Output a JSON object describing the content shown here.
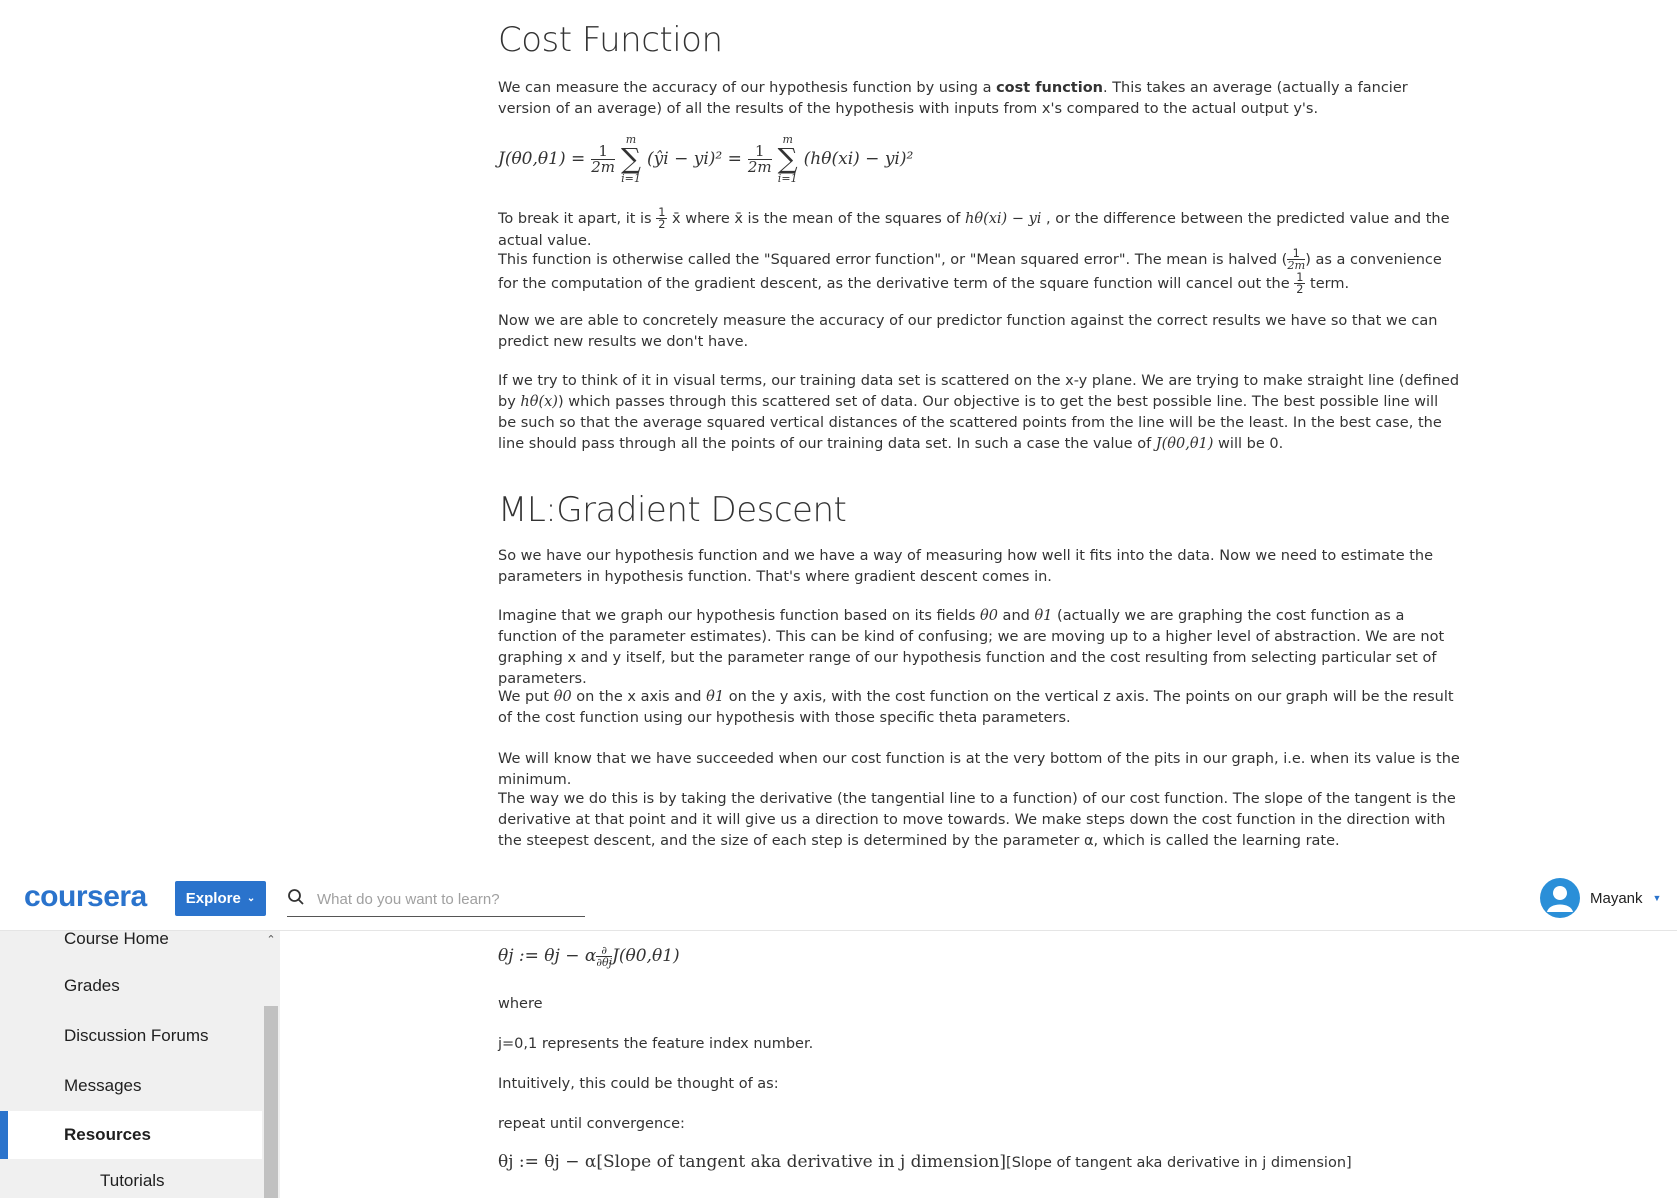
{
  "article": {
    "h1": "Cost Function",
    "p1_a": "We can measure the accuracy of our hypothesis function by using a ",
    "p1_bold": "cost function",
    "p1_b": ". This takes an average (actually a fancier version of an average) of all the results of the hypothesis with inputs from x's compared to the actual output y's.",
    "eq1": {
      "lhs": "J(θ0,θ1) =",
      "frac_num": "1",
      "frac_den": "2m",
      "sum_top": "m",
      "sum_bot": "i=1",
      "term1": "(ŷi − yi)² =",
      "term2": "(hθ(xi) − yi)²"
    },
    "p2_a": "To break it apart, it is ",
    "p2_frac_num": "1",
    "p2_frac_den": "2",
    "p2_b": " x̄ where x̄ is the mean of the squares of ",
    "p2_math": "hθ(xi) − yi",
    "p2_c": " , or the difference between the predicted value and the actual value.",
    "p3_a": "This function is otherwise called the \"Squared error function\", or \"Mean squared error\". The mean is halved ",
    "p3_frac_num": "1",
    "p3_frac_den": "2m",
    "p3_b": " as a convenience for the computation of the gradient descent, as the derivative term of the square function will cancel out the ",
    "p3_frac2_num": "1",
    "p3_frac2_den": "2",
    "p3_c": " term.",
    "p4": "Now we are able to concretely measure the accuracy of our predictor function against the correct results we have so that we can predict new results we don't have.",
    "p5_a": "If we try to think of it in visual terms, our training data set is scattered on the x-y plane. We are trying to make straight line (defined by ",
    "p5_math1": "hθ(x)",
    "p5_b": ") which passes through this scattered set of data. Our objective is to get the best possible line. The best possible line will be such so that the average squared vertical distances of the scattered points from the line will be the least. In the best case, the line should pass through all the points of our training data set. In such a case the value of ",
    "p5_math2": "J(θ0,θ1)",
    "p5_c": " will be 0.",
    "h2": "ML:Gradient Descent",
    "p6": "So we have our hypothesis function and we have a way of measuring how well it fits into the data. Now we need to estimate the parameters in hypothesis function. That's where gradient descent comes in.",
    "p7_a": "Imagine that we graph our hypothesis function based on its fields ",
    "p7_m1": "θ0",
    "p7_b": " and ",
    "p7_m2": "θ1",
    "p7_c": " (actually we are graphing the cost function as a function of the parameter estimates). This can be kind of confusing; we are moving up to a higher level of abstraction. We are not graphing x and y itself, but the parameter range of our hypothesis function and the cost resulting from selecting particular set of parameters.",
    "p8_a": "We put ",
    "p8_m1": "θ0",
    "p8_b": " on the x axis and ",
    "p8_m2": "θ1",
    "p8_c": " on the y axis, with the cost function on the vertical z axis. The points on our graph will be the result of the cost function using our hypothesis with those specific theta parameters.",
    "p9": "We will know that we have succeeded when our cost function is at the very bottom of the pits in our graph, i.e. when its value is the minimum.",
    "p10": "The way we do this is by taking the derivative (the tangential line to a function) of our cost function. The slope of the tangent is the derivative at that point and it will give us a direction to move towards. We make steps down the cost function in the direction with the steepest descent, and the size of each step is determined by the parameter α, which is called the learning rate."
  },
  "lower": {
    "eq_a": "θj := θj − α",
    "eq_frac_num": "∂",
    "eq_frac_den": "∂θj",
    "eq_b": "J(θ0,θ1)",
    "where": "where",
    "j_line": "j=0,1 represents the feature index number.",
    "intuitively": "Intuitively, this could be thought of as:",
    "repeat": "repeat until convergence:",
    "eq2_math": "θj := θj − α[Slope of tangent aka derivative in j dimension]",
    "eq2_text": "[Slope of tangent aka derivative in j dimension]"
  },
  "header": {
    "logo": "coursera",
    "explore_label": "Explore",
    "search_placeholder": "What do you want to learn?",
    "user_name": "Mayank"
  },
  "sidebar": {
    "items": [
      {
        "label": "Course Home"
      },
      {
        "label": "Grades"
      },
      {
        "label": "Discussion Forums"
      },
      {
        "label": "Messages"
      },
      {
        "label": "Resources"
      },
      {
        "label": "Tutorials"
      }
    ]
  },
  "colors": {
    "brand_blue": "#2a73cc",
    "avatar_blue": "#2a8fd8",
    "sidebar_bg": "#f0f0f0",
    "text": "#333333"
  }
}
